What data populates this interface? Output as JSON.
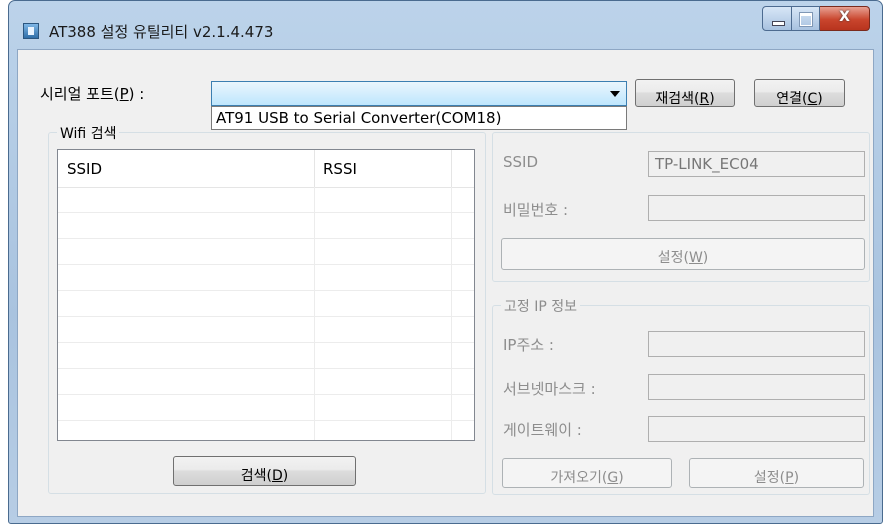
{
  "window": {
    "title": "AT388 설정 유틸리티 v2.1.4.473",
    "caption_buttons": {
      "minimize": "-",
      "maximize": "□",
      "close": "X"
    }
  },
  "serial": {
    "label_prefix": "시리얼 포트(",
    "label_key": "P",
    "label_suffix": ") :",
    "selected": "",
    "dropdown_option": "AT91 USB to Serial Converter(COM18)",
    "rescan": {
      "prefix": "재검색(",
      "key": "R",
      "suffix": ")"
    },
    "connect": {
      "prefix": "연결(",
      "key": "C",
      "suffix": ")"
    }
  },
  "wifi_scan": {
    "group_title": "Wifi 검색",
    "columns": [
      "SSID",
      "RSSI"
    ],
    "rows": [],
    "search_button": {
      "prefix": "검색(",
      "key": "D",
      "suffix": ")"
    }
  },
  "wifi_settings": {
    "ssid_label": "SSID",
    "ssid_value": "TP-LINK_EC04",
    "password_label": "비밀번호 :",
    "password_value": "",
    "set_button": {
      "prefix": "설정(",
      "key": "W",
      "suffix": ")"
    }
  },
  "static_ip": {
    "group_title": "고정 IP 정보",
    "ip_label": "IP주소 :",
    "subnet_label": "서브넷마스크 :",
    "gateway_label": "게이트웨이 :",
    "ip_value": "",
    "subnet_value": "",
    "gateway_value": "",
    "fetch_button": {
      "prefix": "가져오기(",
      "key": "G",
      "suffix": ")"
    },
    "set_button": {
      "prefix": "설정(",
      "key": "P",
      "suffix": ")"
    }
  }
}
